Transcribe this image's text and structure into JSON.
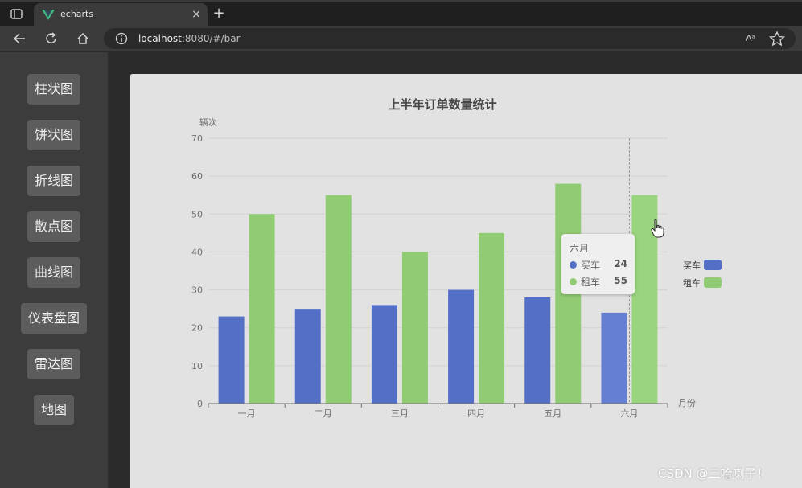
{
  "browser": {
    "tab_title": "echarts",
    "new_tab": "+",
    "close": "×",
    "url_host": "localhost",
    "url_rest": ":8080/#/bar",
    "read_aloud": "Aᵃ",
    "icons": [
      "window-icon",
      "vue-logo-icon",
      "back-icon",
      "reload-icon",
      "home-icon",
      "info-icon",
      "star-icon"
    ]
  },
  "sidebar": {
    "items": [
      {
        "label": "柱状图"
      },
      {
        "label": "饼状图"
      },
      {
        "label": "折线图"
      },
      {
        "label": "散点图"
      },
      {
        "label": "曲线图"
      },
      {
        "label": "仪表盘图"
      },
      {
        "label": "雷达图"
      },
      {
        "label": "地图"
      }
    ]
  },
  "chart_data": {
    "type": "bar",
    "title": "上半年订单数量统计",
    "ylabel": "辆次",
    "xlabel": "月份",
    "categories": [
      "一月",
      "二月",
      "三月",
      "四月",
      "五月",
      "六月"
    ],
    "ylim": [
      0,
      70
    ],
    "yticks": [
      "0",
      "10",
      "20",
      "30",
      "40",
      "50",
      "60",
      "70"
    ],
    "grid": true,
    "legend_position": "right",
    "series": [
      {
        "name": "买车",
        "values": [
          23,
          25,
          26,
          30,
          28,
          24
        ],
        "color": "#5470c6"
      },
      {
        "name": "租车",
        "values": [
          50,
          55,
          40,
          45,
          58,
          55
        ],
        "color": "#91cc75"
      }
    ],
    "highlighted_category": "六月"
  },
  "tooltip": {
    "title": "六月",
    "rows": [
      {
        "name": "买车",
        "value": "24",
        "color": "#5470c6"
      },
      {
        "name": "租车",
        "value": "55",
        "color": "#91cc75"
      }
    ]
  },
  "watermark": "CSDN @二哈喇子！"
}
